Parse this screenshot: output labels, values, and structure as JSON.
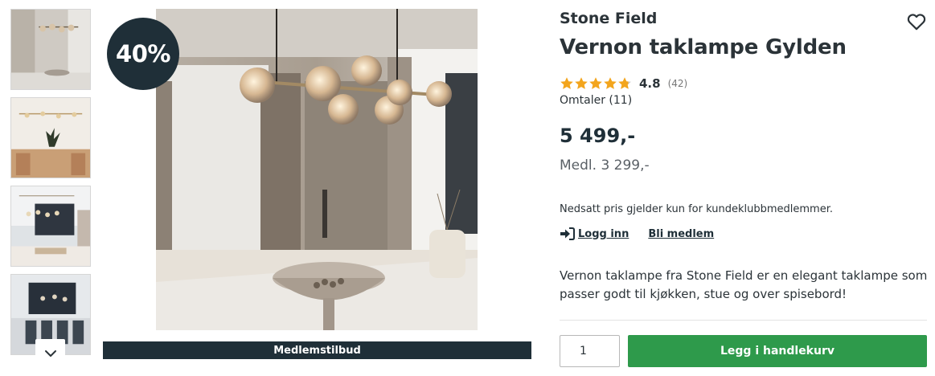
{
  "gallery": {
    "thumbnails": [
      {
        "alt": "thumbnail-1"
      },
      {
        "alt": "thumbnail-2"
      },
      {
        "alt": "thumbnail-3"
      },
      {
        "alt": "thumbnail-4"
      }
    ],
    "scroll_icon": "chevron-down-icon",
    "discount_badge": "40%",
    "member_banner": "Medlemstilbud"
  },
  "product": {
    "brand": "Stone Field",
    "title": "Vernon taklampe Gylden",
    "rating": {
      "value": "4.8",
      "count": "(42)",
      "stars_filled": 4.8,
      "star_color": "#f3a51d",
      "star_empty_color": "#c8c8c8"
    },
    "reviews_label": "Omtaler (11)",
    "price": "5 499,-",
    "member_price": "Medl. 3 299,-",
    "notice": "Nedsatt pris gjelder kun for kundeklubbmedlemmer.",
    "login_label": "Logg inn",
    "login_icon": "sign-in-icon",
    "join_label": "Bli medlem",
    "description": "Vernon taklampe fra Stone Field er en elegant taklampe som passer godt til kjøkken, stue og over spisebord!",
    "favorite_icon": "heart-outline-icon"
  },
  "purchase": {
    "quantity": "1",
    "add_to_cart_label": "Legg i handlekurv",
    "button_color": "#2e9a4b"
  },
  "colors": {
    "dark": "#1f2f38",
    "accent_green": "#2e9a4b"
  }
}
